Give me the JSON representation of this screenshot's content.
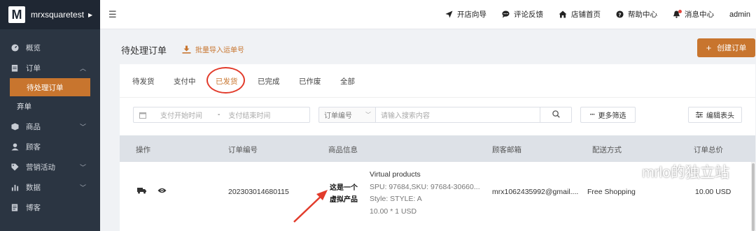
{
  "brand": {
    "logo_letter": "M",
    "name": "mrxsquaretest"
  },
  "sidebar": {
    "items": [
      {
        "label": "概览",
        "icon": "dashboard-icon"
      },
      {
        "label": "订单",
        "icon": "order-icon",
        "expanded": true
      },
      {
        "label": "待处理订单",
        "sub": true,
        "active": true
      },
      {
        "label": "弃单",
        "sub": true
      },
      {
        "label": "商品",
        "icon": "product-icon"
      },
      {
        "label": "顾客",
        "icon": "customer-icon"
      },
      {
        "label": "营销活动",
        "icon": "tag-icon"
      },
      {
        "label": "数据",
        "icon": "chart-icon"
      },
      {
        "label": "博客",
        "icon": "blog-icon"
      }
    ]
  },
  "topbar": {
    "links": [
      {
        "label": "开店向导",
        "icon": "paper-plane-icon"
      },
      {
        "label": "评论反馈",
        "icon": "comment-icon"
      },
      {
        "label": "店铺首页",
        "icon": "home-icon"
      },
      {
        "label": "帮助中心",
        "icon": "help-icon"
      },
      {
        "label": "消息中心",
        "icon": "bell-icon"
      }
    ],
    "user": "admin"
  },
  "page": {
    "title": "待处理订单",
    "import_label": "批量导入运单号",
    "create_label": "创建订单"
  },
  "tabs": [
    "待发货",
    "支付中",
    "已发货",
    "已完成",
    "已作废",
    "全部"
  ],
  "active_tab": "已发货",
  "filters": {
    "date_start_placeholder": "支付开始时间",
    "date_sep": "-",
    "date_end_placeholder": "支付结束时间",
    "search_field": "订单编号",
    "search_placeholder": "请输入搜索内容",
    "more_label": "更多筛选",
    "edit_label": "编辑表头"
  },
  "table": {
    "headers": [
      "操作",
      "订单编号",
      "商品信息",
      "顾客邮箱",
      "配送方式",
      "订单总价"
    ],
    "rows": [
      {
        "order_no": "202303014680115",
        "thumb_line1": "这是一个",
        "thumb_line2": "虚拟产品",
        "product_name": "Virtual products",
        "product_sku": "SPU: 97684,SKU: 97684-30660...",
        "product_style": "Style: STYLE: A",
        "product_price": "10.00 * 1 USD",
        "email": "mrx1062435992@gmail....",
        "shipping": "Free Shopping",
        "total": "10.00 USD"
      }
    ]
  },
  "watermark": "mrlo的独立站",
  "colors": {
    "accent": "#c8752e",
    "sidebar": "#2b3542",
    "annotation": "#e23b2b"
  }
}
